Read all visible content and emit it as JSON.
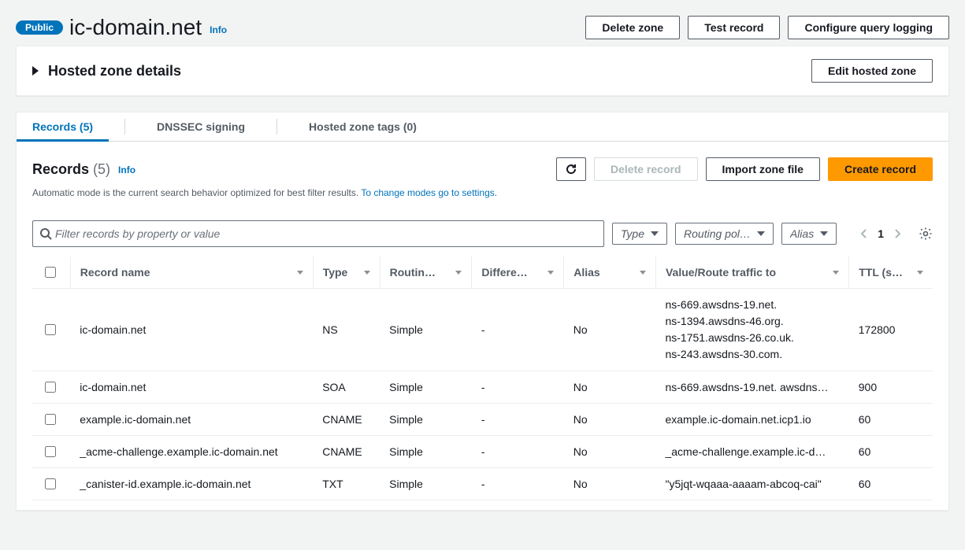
{
  "header": {
    "badge": "Public",
    "title": "ic-domain.net",
    "info": "Info",
    "actions": {
      "delete_zone": "Delete zone",
      "test_record": "Test record",
      "configure_logging": "Configure query logging"
    }
  },
  "details_panel": {
    "title": "Hosted zone details",
    "edit_button": "Edit hosted zone"
  },
  "tabs": {
    "records": "Records (5)",
    "dnssec": "DNSSEC signing",
    "tags": "Hosted zone tags (0)"
  },
  "records_panel": {
    "title": "Records",
    "count_suffix": "(5)",
    "info": "Info",
    "subtext_static": "Automatic mode is the current search behavior optimized for best filter results. ",
    "subtext_link": "To change modes go to settings.",
    "actions": {
      "delete_record": "Delete record",
      "import_zone": "Import zone file",
      "create_record": "Create record"
    },
    "search_placeholder": "Filter records by property or value",
    "filters": {
      "type": "Type",
      "routing": "Routing pol…",
      "alias": "Alias"
    },
    "page": "1"
  },
  "table": {
    "columns": {
      "name": "Record name",
      "type": "Type",
      "routing": "Routin…",
      "diff": "Differe…",
      "alias": "Alias",
      "value": "Value/Route traffic to",
      "ttl": "TTL (s…"
    },
    "rows": [
      {
        "name": "ic-domain.net",
        "type": "NS",
        "routing": "Simple",
        "diff": "-",
        "alias": "No",
        "value": "ns-669.awsdns-19.net.\nns-1394.awsdns-46.org.\nns-1751.awsdns-26.co.uk.\nns-243.awsdns-30.com.",
        "ttl": "172800"
      },
      {
        "name": "ic-domain.net",
        "type": "SOA",
        "routing": "Simple",
        "diff": "-",
        "alias": "No",
        "value": "ns-669.awsdns-19.net. awsdns…",
        "ttl": "900"
      },
      {
        "name": "example.ic-domain.net",
        "type": "CNAME",
        "routing": "Simple",
        "diff": "-",
        "alias": "No",
        "value": "example.ic-domain.net.icp1.io",
        "ttl": "60"
      },
      {
        "name": "_acme-challenge.example.ic-domain.net",
        "type": "CNAME",
        "routing": "Simple",
        "diff": "-",
        "alias": "No",
        "value": "_acme-challenge.example.ic-d…",
        "ttl": "60"
      },
      {
        "name": "_canister-id.example.ic-domain.net",
        "type": "TXT",
        "routing": "Simple",
        "diff": "-",
        "alias": "No",
        "value": "\"y5jqt-wqaaa-aaaam-abcoq-cai\"",
        "ttl": "60"
      }
    ]
  }
}
